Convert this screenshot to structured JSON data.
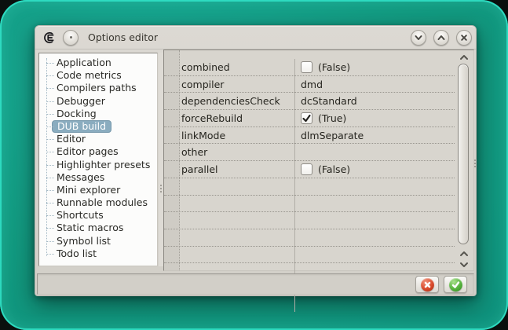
{
  "colors": {
    "desktop_teal": "#12997f",
    "desktop_edge_glow": "#31e4c9",
    "window_bg": "#d6d3cc",
    "selection_bg": "#8aacbf",
    "cancel_red": "#d94a2b",
    "ok_green": "#56b23d"
  },
  "window": {
    "title": "Options editor"
  },
  "sidebar": {
    "selected_item": "DUB build",
    "items": [
      "Application",
      "Code metrics",
      "Compilers paths",
      "Debugger",
      "Docking",
      "DUB build",
      "Editor",
      "Editor pages",
      "Highlighter presets",
      "Messages",
      "Mini explorer",
      "Runnable modules",
      "Shortcuts",
      "Static macros",
      "Symbol list",
      "Todo list"
    ]
  },
  "property_grid": {
    "rows": [
      {
        "name": "combined",
        "type": "checkbox",
        "checked": false,
        "display": "(False)"
      },
      {
        "name": "compiler",
        "type": "text",
        "display": "dmd"
      },
      {
        "name": "dependenciesCheck",
        "type": "text",
        "display": "dcStandard"
      },
      {
        "name": "forceRebuild",
        "type": "checkbox",
        "checked": true,
        "display": "(True)"
      },
      {
        "name": "linkMode",
        "type": "text",
        "display": "dlmSeparate"
      },
      {
        "name": "other",
        "type": "text",
        "display": ""
      },
      {
        "name": "parallel",
        "type": "checkbox",
        "checked": false,
        "display": "(False)"
      }
    ]
  }
}
